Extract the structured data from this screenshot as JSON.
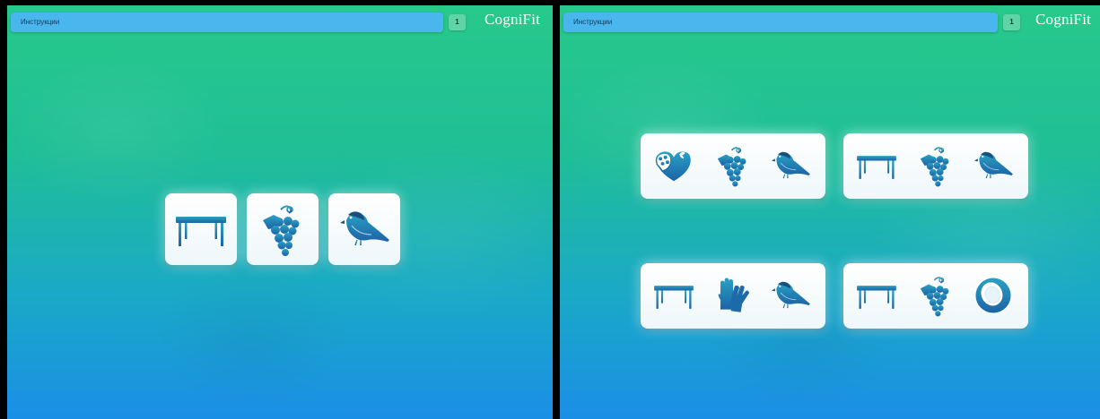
{
  "panels": [
    {
      "topbar_label": "Инструкции",
      "counter": "1",
      "logo": "CogniFit",
      "cards": [
        {
          "icons": [
            "table-icon"
          ]
        },
        {
          "icons": [
            "grapes-icon"
          ]
        },
        {
          "icons": [
            "sparrow-icon"
          ]
        }
      ]
    },
    {
      "topbar_label": "Инструкции",
      "counter": "1",
      "logo": "CogniFit",
      "cards": [
        {
          "icons": [
            "heart-chocolate-box-icon",
            "grapes-icon",
            "sparrow-icon"
          ]
        },
        {
          "icons": [
            "table-icon",
            "grapes-icon",
            "sparrow-icon"
          ]
        },
        {
          "icons": [
            "table-icon",
            "gloves-icon",
            "sparrow-icon"
          ]
        },
        {
          "icons": [
            "table-icon",
            "grapes-icon",
            "coconut-icon"
          ]
        }
      ]
    }
  ],
  "colors": {
    "background_top": "#27c98b",
    "background_bottom": "#1a8fe6",
    "topbar": "#4ab6ee",
    "counter": "#5fd4a4",
    "icon": "#1f7fb3"
  }
}
